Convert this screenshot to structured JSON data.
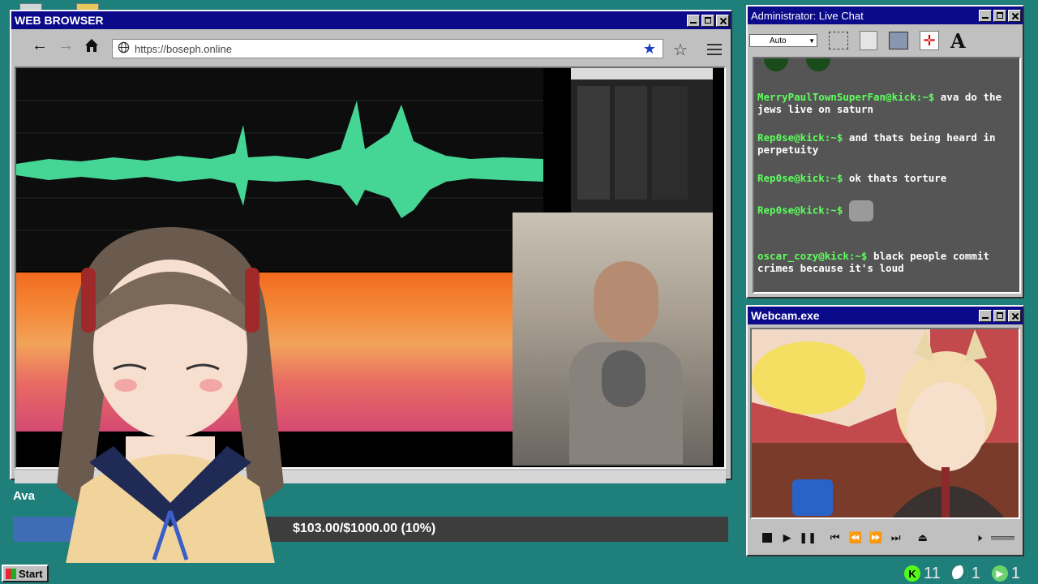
{
  "browser": {
    "title": "WEB BROWSER",
    "url": "https://boseph.online"
  },
  "chat": {
    "title": "Administrator: Live Chat",
    "font_select": "Auto",
    "messages": [
      {
        "user": "MerryPaulTownSuperFan@kick:~$",
        "text": "ava do the jews live on saturn"
      },
      {
        "user": "Rep0se@kick:~$",
        "text": "and thats being heard in perpetuity"
      },
      {
        "user": "Rep0se@kick:~$",
        "text": "ok thats torture"
      },
      {
        "user": "Rep0se@kick:~$",
        "text": ""
      },
      {
        "user": "oscar_cozy@kick:~$",
        "text": "black people commit crimes because it's loud"
      }
    ]
  },
  "webcam": {
    "title": "Webcam.exe"
  },
  "stream": {
    "name_label": "Ava",
    "donation_goal": "$103.00/$1000.00 (10%)",
    "donation_progress": 0.1
  },
  "taskbar": {
    "start_label": "Start",
    "tray": [
      {
        "icon": "kick-icon",
        "count": "11",
        "color": "#53fc18"
      },
      {
        "icon": "moon-icon",
        "count": "1",
        "color": "#ffffff"
      },
      {
        "icon": "play-icon",
        "count": "1",
        "color": "#6bd36b"
      }
    ]
  }
}
